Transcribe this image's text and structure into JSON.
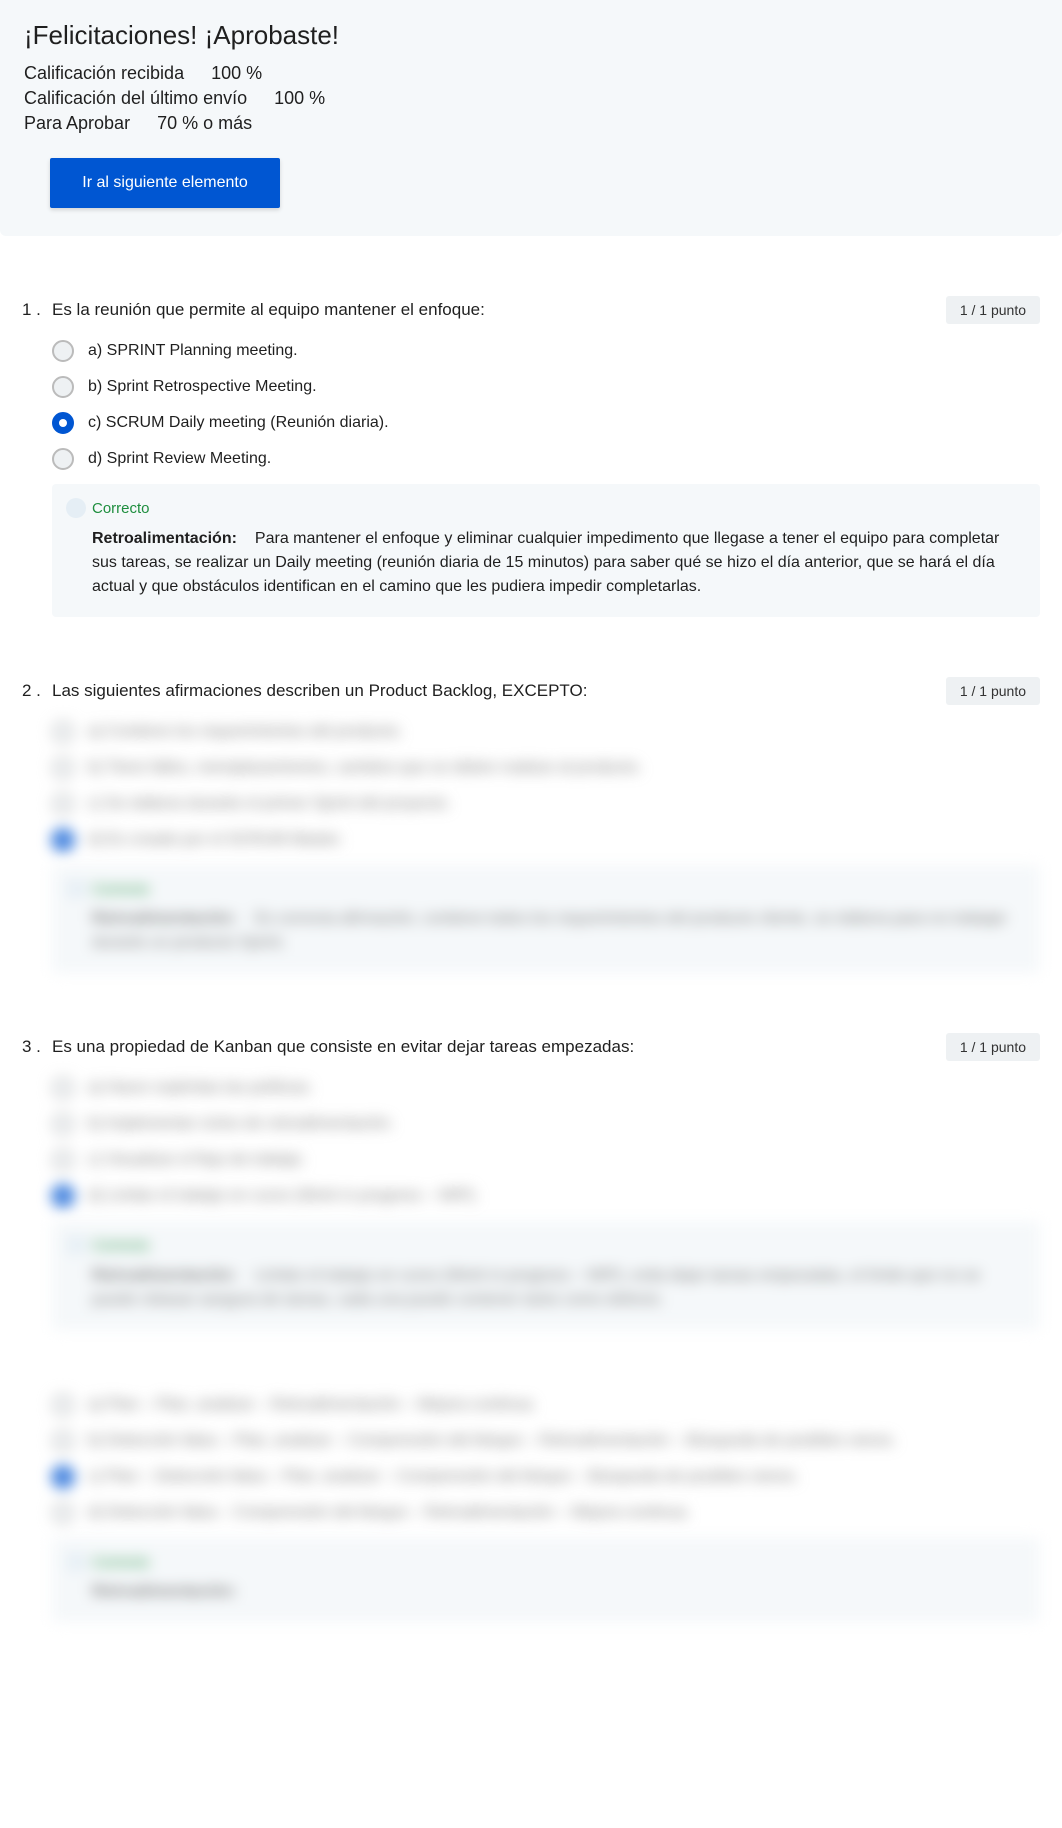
{
  "header": {
    "title": "¡Felicitaciones! ¡Aprobaste!",
    "rows": [
      {
        "label": "Calificación recibida",
        "value": "100 %"
      },
      {
        "label": "Calificación del último envío",
        "value": "100 %"
      },
      {
        "label": "Para Aprobar",
        "value": "70 % o más"
      }
    ],
    "next_button": "Ir al siguiente elemento"
  },
  "points_label": "1 / 1 punto",
  "feedback_labels": {
    "correct": "Correcto",
    "retro": "Retroalimentación:"
  },
  "questions": [
    {
      "number": "1 .",
      "text": "Es la reunión que permite al equipo mantener el enfoque:",
      "options": [
        {
          "text": "a) SPRINT Planning meeting.",
          "selected": false
        },
        {
          "text": "b) Sprint Retrospective Meeting.",
          "selected": false
        },
        {
          "text": "c) SCRUM Daily meeting (Reunión diaria).",
          "selected": true
        },
        {
          "text": "d) Sprint Review Meeting.",
          "selected": false
        }
      ],
      "feedback": "Para mantener el enfoque y eliminar cualquier impedimento que llegase a tener el equipo para completar sus tareas, se realizar un Daily meeting (reunión diaria de 15 minutos) para saber qué se hizo el día anterior, que se hará el día actual y que obstáculos identifican en el camino que les pudiera impedir completarlas.",
      "blurred": false
    },
    {
      "number": "2 .",
      "text": "Las siguientes afirmaciones describen un Product Backlog, EXCEPTO:",
      "options": [
        {
          "text": "a) Contiene los requerimientos del producto.",
          "selected": false
        },
        {
          "text": "b) Tiene fallos, reemplazamientos, cambios que se deben realizar al producto.",
          "selected": false
        },
        {
          "text": "c) Se elabora durante el primer Sprint del proyecto.",
          "selected": false
        },
        {
          "text": "d) Es creado por el SCRUM Master.",
          "selected": true
        }
      ],
      "feedback": "Es correcta afirmación, contiene todos los requerimientos del producto cliente, se elabora para no trabajar durante un producto Sprint.",
      "blurred": true
    },
    {
      "number": "3 .",
      "text": "Es una propiedad de Kanban que consiste en evitar dejar tareas empezadas:",
      "options": [
        {
          "text": "a) Hacer explícitas las políticas.",
          "selected": false
        },
        {
          "text": "b) Implementar ciclos de retroalimentación.",
          "selected": false
        },
        {
          "text": "c) Visualizar el flujo de trabajo.",
          "selected": false
        },
        {
          "text": "d) Limitar el trabajo en curso (Work in progress – WIP).",
          "selected": true
        }
      ],
      "feedback": "Limitar el trabajo en curso (Work in progress – WIP), evita dejar tareas empezadas, el límite que no se puede rebasar asegura de tareas, cada una puede contener tanto como defecto.",
      "blurred": true
    },
    {
      "number": "",
      "text": "",
      "options": [
        {
          "text": "a) Plan – Plan, analizar – Retroalimentación – Mejora continua.",
          "selected": false
        },
        {
          "text": "b) Detección falsa – Plan, analizar – Comprensión del bloque – Retroalimentación – Búsqueda de posibles raíces.",
          "selected": false
        },
        {
          "text": "c) Plan – Detección falsa – Plan, analizar – Comprensión del bloque – Búsqueda de posibles raíces.",
          "selected": true
        },
        {
          "text": "d) Detección falsa – Comprensión del bloque – Retroalimentación – Mejora continua.",
          "selected": false
        }
      ],
      "feedback": "",
      "blurred": true,
      "feedback_only_label": true
    }
  ]
}
